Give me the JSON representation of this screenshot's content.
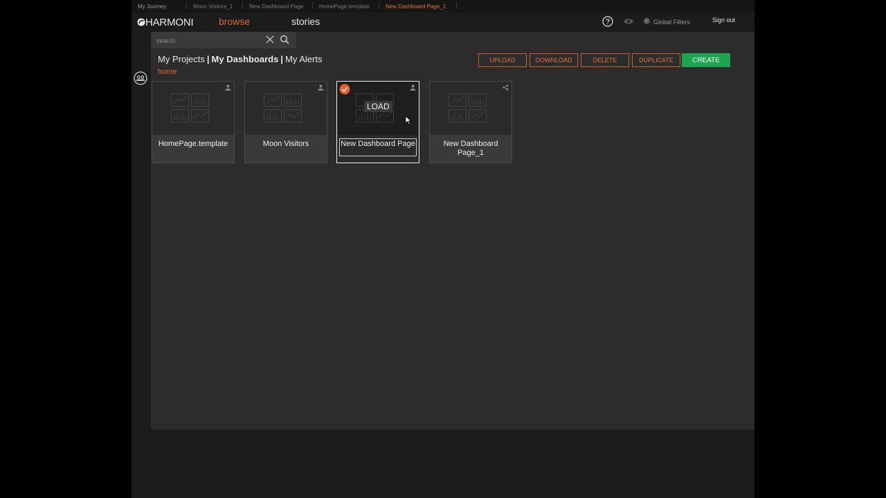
{
  "journey": {
    "title": "My Journey",
    "items": [
      "Moon Visitors_1",
      "New Dashboard Page",
      "HomePage.template",
      "New Dashboard Page_1"
    ],
    "active_index": 3
  },
  "header": {
    "logo_text": "HARMONI",
    "nav_browse": "browse",
    "nav_stories": "stories",
    "global_filters": "Global Filters",
    "sign_out": "Sign out"
  },
  "search": {
    "placeholder": "search"
  },
  "tabs": {
    "projects": "My Projects",
    "dashboards": "My Dashboards",
    "alerts": "My Alerts",
    "separator": "|"
  },
  "breadcrumb": {
    "home": "home"
  },
  "toolbar": {
    "upload": "UPLOAD",
    "download": "DOWNLOAD",
    "delete": "DELETE",
    "duplicate": "DUPLICATE",
    "create": "CREATE"
  },
  "cards": [
    {
      "name": "HomePage.template",
      "owner_icon": "user-icon"
    },
    {
      "name": "Moon Visitors",
      "owner_icon": "user-icon"
    },
    {
      "name": "New Dashboard Page",
      "owner_icon": "user-icon",
      "selected": true,
      "overlay_label": "LOAD"
    },
    {
      "name": "New Dashboard Page_1",
      "owner_icon": "share-icon"
    }
  ],
  "colors": {
    "accent_orange": "#e8622a",
    "create_green": "#1da650",
    "panel": "#2c2c2c",
    "background": "#000000"
  }
}
